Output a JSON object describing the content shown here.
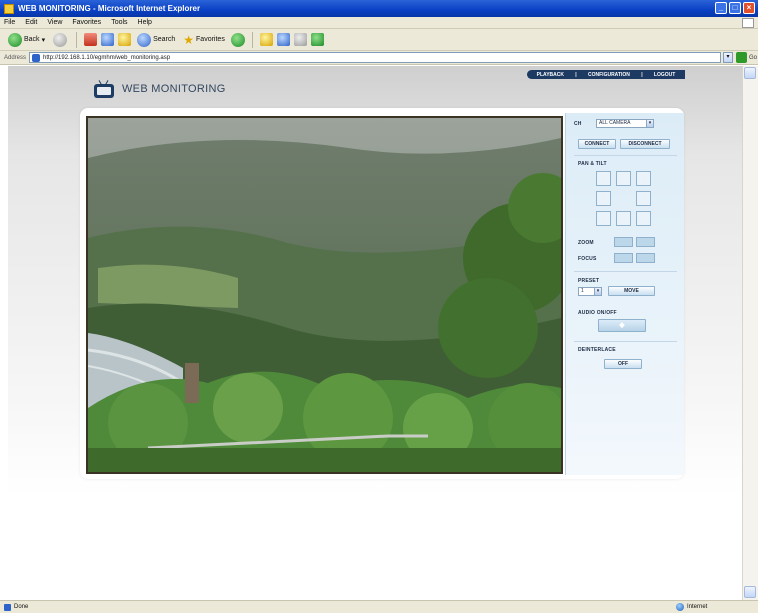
{
  "window": {
    "title": "WEB MONITORING - Microsoft Internet Explorer",
    "menu": [
      "File",
      "Edit",
      "View",
      "Favorites",
      "Tools",
      "Help"
    ]
  },
  "toolbar": {
    "back_label": "Back",
    "search_label": "Search",
    "favorites_label": "Favorites"
  },
  "address": {
    "label": "Address",
    "url": "http://192.168.1.10/egmhm/web_monitoring.asp",
    "go_label": "Go"
  },
  "nav": {
    "items": [
      "PLAYBACK",
      "CONFIGURATION",
      "LOGOUT"
    ],
    "separator": "|"
  },
  "brand": {
    "title": "WEB MONITORING"
  },
  "panel": {
    "ch_label": "CH",
    "ch_value": "ALL CAMERA",
    "connect": "CONNECT",
    "disconnect": "DISCONNECT",
    "pantilt": "PAN & TILT",
    "zoom": "ZOOM",
    "focus": "FOCUS",
    "preset": "PRESET",
    "preset_value": "1",
    "preset_btn": "MOVE",
    "audio": "AUDIO ON/OFF",
    "audio_icon": "speaker-icon",
    "deinterlace": "DEINTERLACE",
    "deinterlace_btn": "OFF"
  },
  "status": {
    "left": "Done",
    "zone": "Internet"
  }
}
